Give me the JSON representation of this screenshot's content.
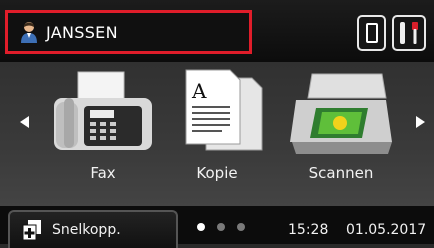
{
  "header": {
    "user_name": "JANSSEN"
  },
  "tiles": [
    {
      "label": "Fax",
      "icon": "fax-machine-icon"
    },
    {
      "label": "Kopie",
      "icon": "copy-documents-icon"
    },
    {
      "label": "Scannen",
      "icon": "flatbed-scanner-icon"
    }
  ],
  "footer": {
    "shortcut_label": "Snelkopp.",
    "time": "15:28",
    "date": "01.05.2017",
    "page_count": 3,
    "active_page": 1
  },
  "colors": {
    "selection_border": "#e01d2a",
    "background": "#333333",
    "text": "#ffffff"
  }
}
